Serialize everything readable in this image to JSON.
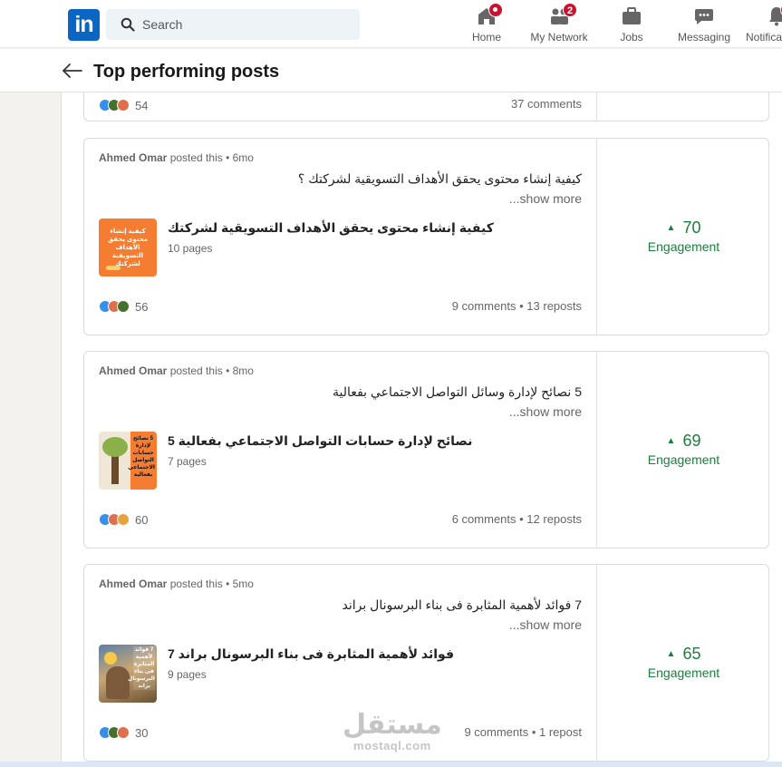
{
  "nav": {
    "logo_text": "in",
    "search_placeholder": "Search",
    "items": [
      {
        "label": "Home",
        "badge": ""
      },
      {
        "label": "My Network",
        "badge": "2"
      },
      {
        "label": "Jobs",
        "badge": ""
      },
      {
        "label": "Messaging",
        "badge": ""
      },
      {
        "label": "Notifications",
        "badge": ""
      }
    ]
  },
  "header": {
    "title": "Top performing posts"
  },
  "partial_card": {
    "reaction_count": "54",
    "stats": "37 comments"
  },
  "posts": [
    {
      "author": "Ahmed Omar",
      "posted_suffix": " posted this • 6mo",
      "text": "كيفية إنشاء محتوى يحقق الأهداف التسويقية لشركتك ؟",
      "show_more": "...show more",
      "doc_title": "كيفية إنشاء محتوى يحقق الأهداف التسويقية لشركتك",
      "doc_pages": "10 pages",
      "thumb_text": "كيفية إنشاء محتوى يحقق الأهداف التسويقية لشركتك",
      "reaction_count": "56",
      "stats": "9 comments • 13 reposts",
      "engagement": "70",
      "engagement_label": "Engagement"
    },
    {
      "author": "Ahmed Omar",
      "posted_suffix": " posted this • 8mo",
      "text": "5 نصائح لإدارة وسائل التواصل الاجتماعي بفعالية",
      "show_more": "...show more",
      "doc_title": "نصائح لإدارة حسابات التواصل الاجتماعي بفعالية 5",
      "doc_pages": "7 pages",
      "thumb_text": "5 نصائح لإدارة حسابات التواصل الاجتماعي بفعالية",
      "reaction_count": "60",
      "stats": "6 comments • 12 reposts",
      "engagement": "69",
      "engagement_label": "Engagement"
    },
    {
      "author": "Ahmed Omar",
      "posted_suffix": " posted this • 5mo",
      "text": "7 فوائد لأهمية المثابرة فى بناء البرسونال براند",
      "show_more": "...show more",
      "doc_title": "فوائد لأهمية المثابرة فى بناء البرسونال براند 7",
      "doc_pages": "9 pages",
      "thumb_text": "7 فوائد لأهمية المثابرة فى بناء البرسونال براند",
      "reaction_count": "30",
      "stats": "9 comments • 1 repost",
      "engagement": "65",
      "engagement_label": "Engagement"
    }
  ],
  "watermark": {
    "arabic": "مستقل",
    "latin": "mostaql.com"
  },
  "colors": {
    "brand": "#0a66c2",
    "engagement_green": "#1a7f3c",
    "badge_red": "#cb112d"
  }
}
